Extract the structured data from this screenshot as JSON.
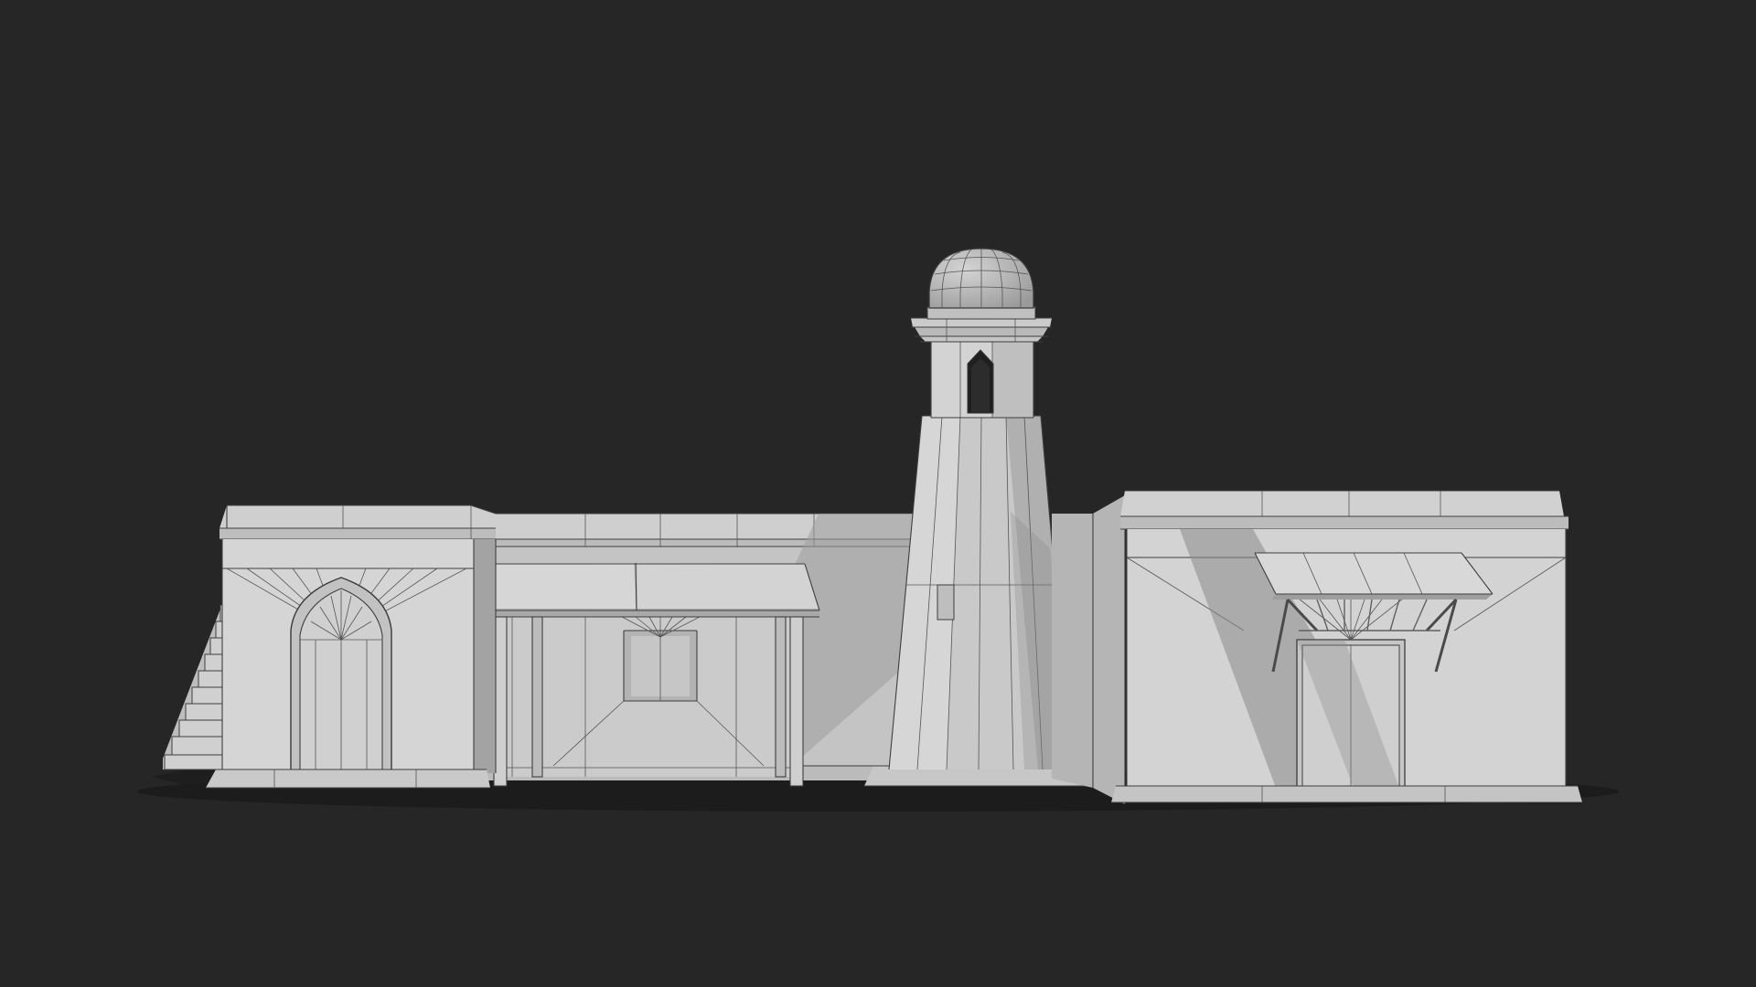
{
  "scene": {
    "subject": "3d-building-model",
    "render_style": "clay-wireframe",
    "parts": [
      "left-house",
      "staircase",
      "arched-doorway",
      "center-wall",
      "porch-canopy",
      "minaret-tower",
      "minaret-dome",
      "right-house",
      "door-awning"
    ]
  },
  "colors": {
    "background": "#262626",
    "surface_light": "#d2d2d2",
    "surface_mid": "#bdbdbd",
    "surface_shadow": "#8a8a8a",
    "wireframe": "#3e3e3e",
    "ground_shadow": "#1b1b1b"
  }
}
